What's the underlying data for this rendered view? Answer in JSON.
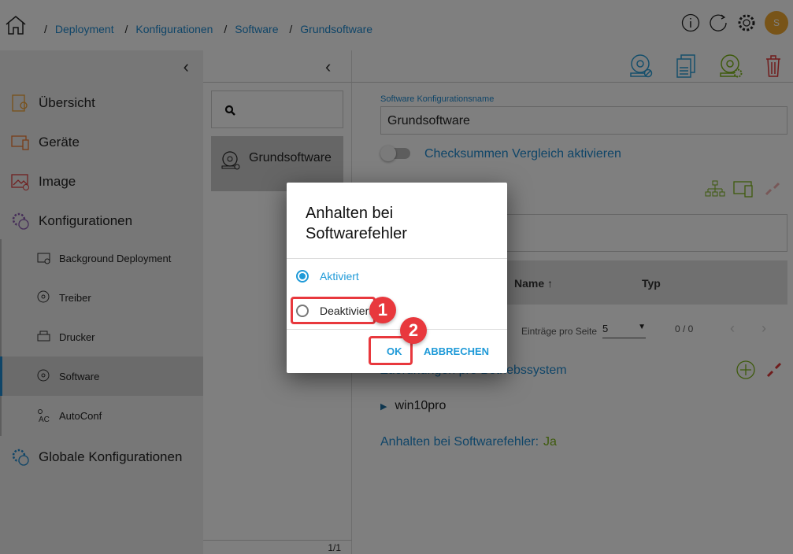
{
  "breadcrumb": [
    "Deployment",
    "Konfigurationen",
    "Software",
    "Grundsoftware"
  ],
  "user": {
    "initial": "S",
    "color": "#f0a830"
  },
  "sidebar": {
    "items": [
      {
        "label": "Übersicht",
        "icon": "overview-icon"
      },
      {
        "label": "Geräte",
        "icon": "devices-icon"
      },
      {
        "label": "Image",
        "icon": "image-icon"
      },
      {
        "label": "Konfigurationen",
        "icon": "configurations-icon"
      }
    ],
    "sub_items": [
      {
        "label": "Background Deployment"
      },
      {
        "label": "Treiber"
      },
      {
        "label": "Drucker"
      },
      {
        "label": "Software",
        "selected": true
      },
      {
        "label": "AutoConf"
      }
    ],
    "global": {
      "label": "Globale Konfigurationen"
    }
  },
  "list": {
    "items": [
      "Grundsoftware"
    ],
    "pager": "1/1"
  },
  "main": {
    "name_label": "Software Konfigurationsname",
    "name_value": "Grundsoftware",
    "checksum_label": "Checksummen Vergleich aktivieren",
    "checksum_enabled": false,
    "table_headers": [
      "Name ↑",
      "Typ"
    ],
    "entries_label": "Einträge pro Seite",
    "entries_value": "5",
    "count": "0 / 0",
    "section_title": "Zuordnungen pro Betriebssystem",
    "os_item": "win10pro",
    "halt_label": "Anhalten bei Softwarefehler:",
    "halt_value": "Ja"
  },
  "dialog": {
    "title": "Anhalten bei Softwarefehler",
    "options": [
      {
        "label": "Aktiviert",
        "selected": true
      },
      {
        "label": "Deaktiviert",
        "selected": false
      }
    ],
    "ok": "OK",
    "cancel": "ABBRECHEN"
  },
  "annotations": [
    "1",
    "2"
  ]
}
